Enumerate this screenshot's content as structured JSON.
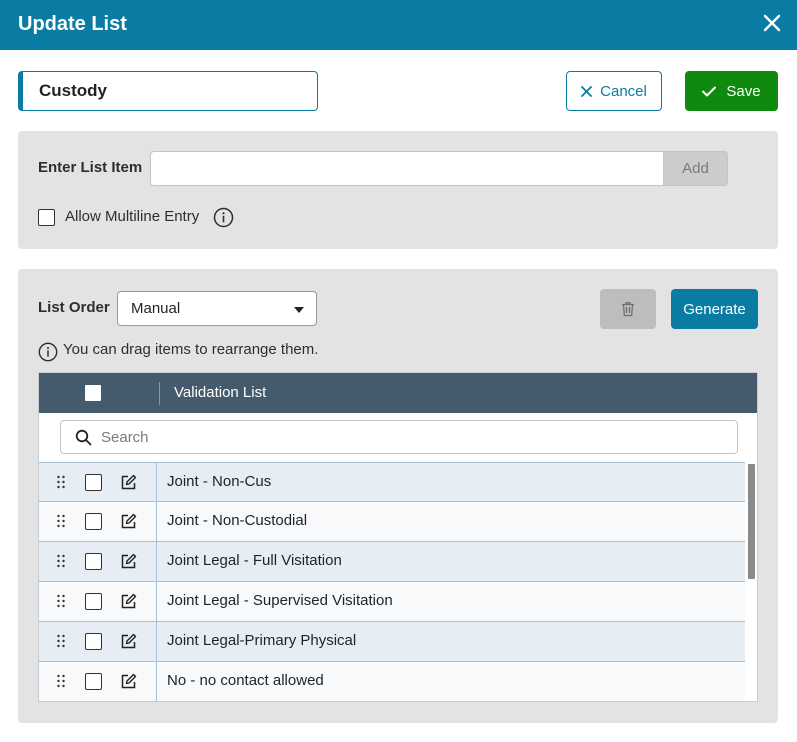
{
  "dialog": {
    "title": "Update List",
    "close_icon": "close-icon"
  },
  "list_name": {
    "value": "Custody"
  },
  "actions": {
    "cancel_label": "Cancel",
    "save_label": "Save"
  },
  "entry_panel": {
    "label": "Enter List Item",
    "input_value": "",
    "add_label": "Add",
    "multiline_label": "Allow Multiline Entry",
    "multiline_checked": false
  },
  "order_panel": {
    "label": "List Order",
    "selected": "Manual",
    "delete_icon": "trash-icon",
    "generate_label": "Generate",
    "drag_note": "You can drag items to rearrange them."
  },
  "grid": {
    "header_title": "Validation List",
    "search_placeholder": "Search",
    "rows": [
      {
        "text": "Joint - Non-Cus"
      },
      {
        "text": "Joint - Non-Custodial"
      },
      {
        "text": "Joint Legal - Full Visitation"
      },
      {
        "text": "Joint Legal - Supervised Visitation"
      },
      {
        "text": "Joint Legal-Primary Physical"
      },
      {
        "text": "No - no contact allowed"
      }
    ]
  },
  "colors": {
    "header": "#0a7ca3",
    "save": "#0f8a0f",
    "grid_header": "#465a6e"
  }
}
